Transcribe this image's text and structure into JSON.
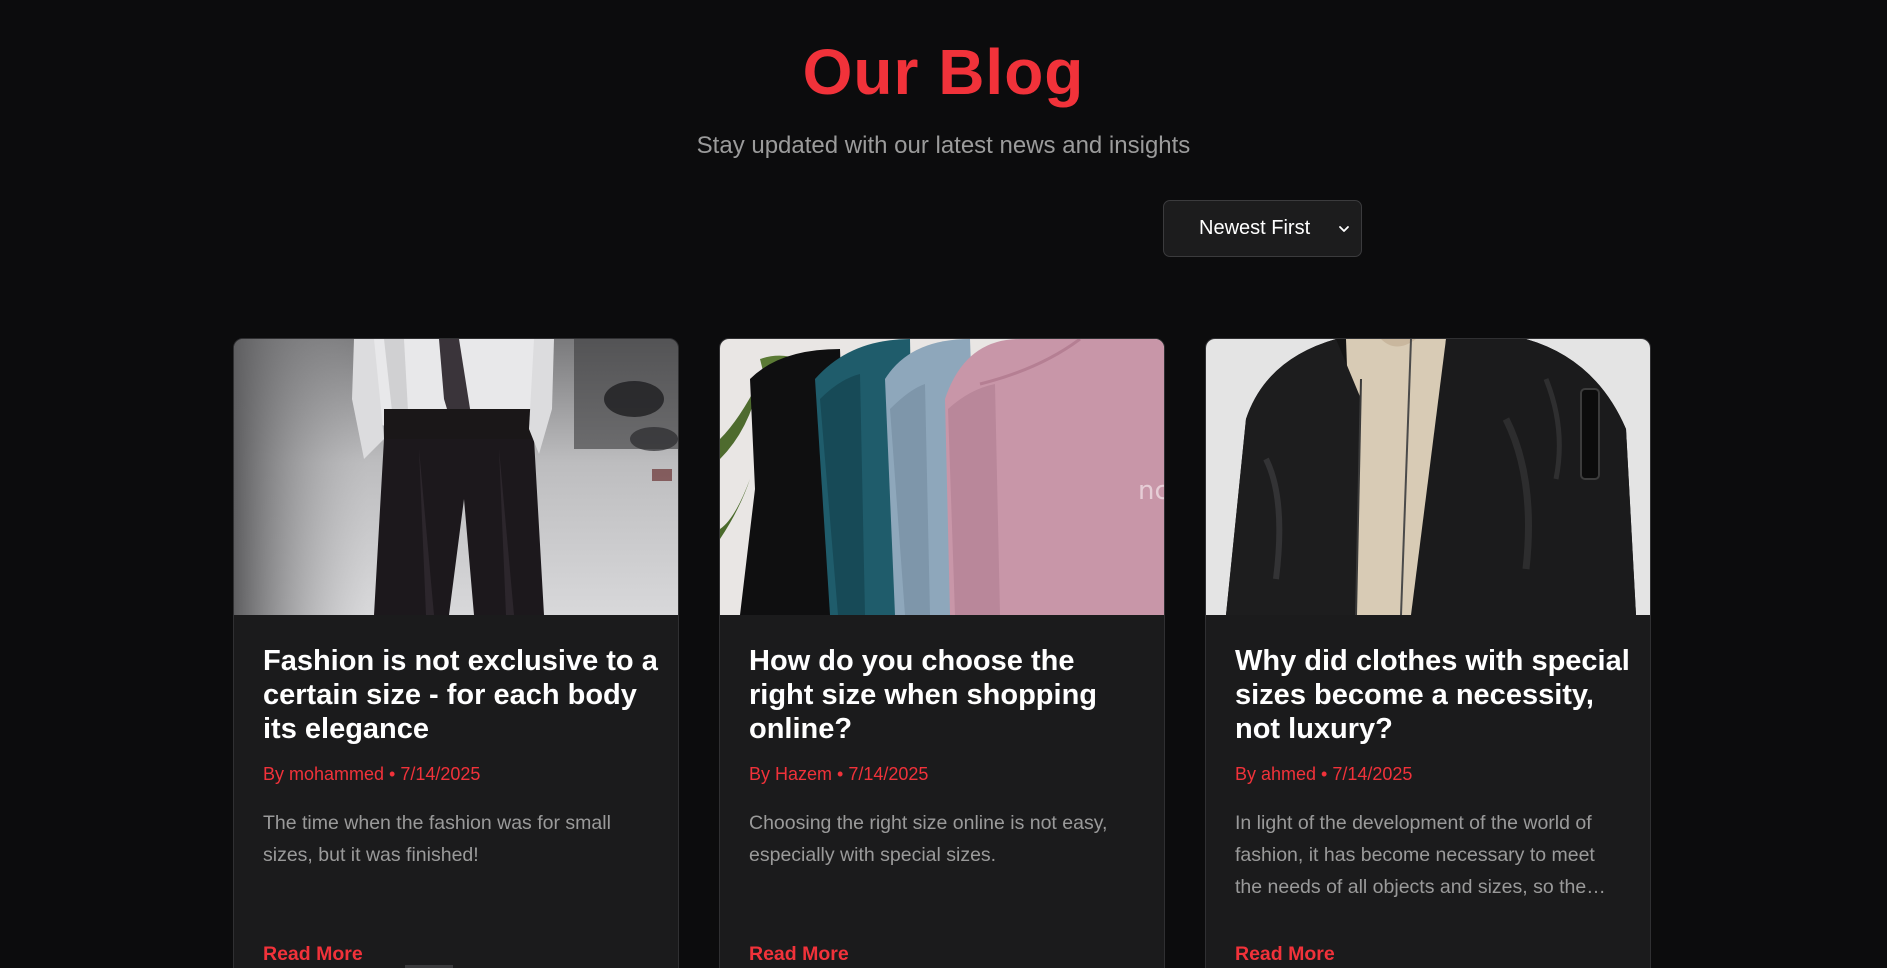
{
  "header": {
    "title": "Our Blog",
    "subtitle": "Stay updated with our latest news and insights"
  },
  "sort": {
    "selected": "Newest First"
  },
  "posts": [
    {
      "title": "Fashion is not exclusive to a certain size - for each body its elegance",
      "meta": "By mohammed • 7/14/2025",
      "excerpt": "The time when the fashion was for small sizes, but it was finished!",
      "read_more": "Read More",
      "image": "fashion-runway-photo"
    },
    {
      "title": "How do you choose the right size when shopping online?",
      "meta": "By Hazem • 7/14/2025",
      "excerpt": "Choosing the right size online is not easy, especially with special sizes.",
      "read_more": "Read More",
      "image": "sweatshirts-on-rack-photo"
    },
    {
      "title": "Why did clothes with special sizes become a necessity, not luxury?",
      "meta": "By ahmed • 7/14/2025",
      "excerpt": "In light of the development of the world of fashion, it has become necessary to meet the needs of all objects and sizes, so the…",
      "read_more": "Read More",
      "image": "black-bomber-jacket-photo"
    }
  ],
  "colors": {
    "accent": "#f1323a",
    "background": "#0c0c0d",
    "card": "#1b1b1c"
  }
}
